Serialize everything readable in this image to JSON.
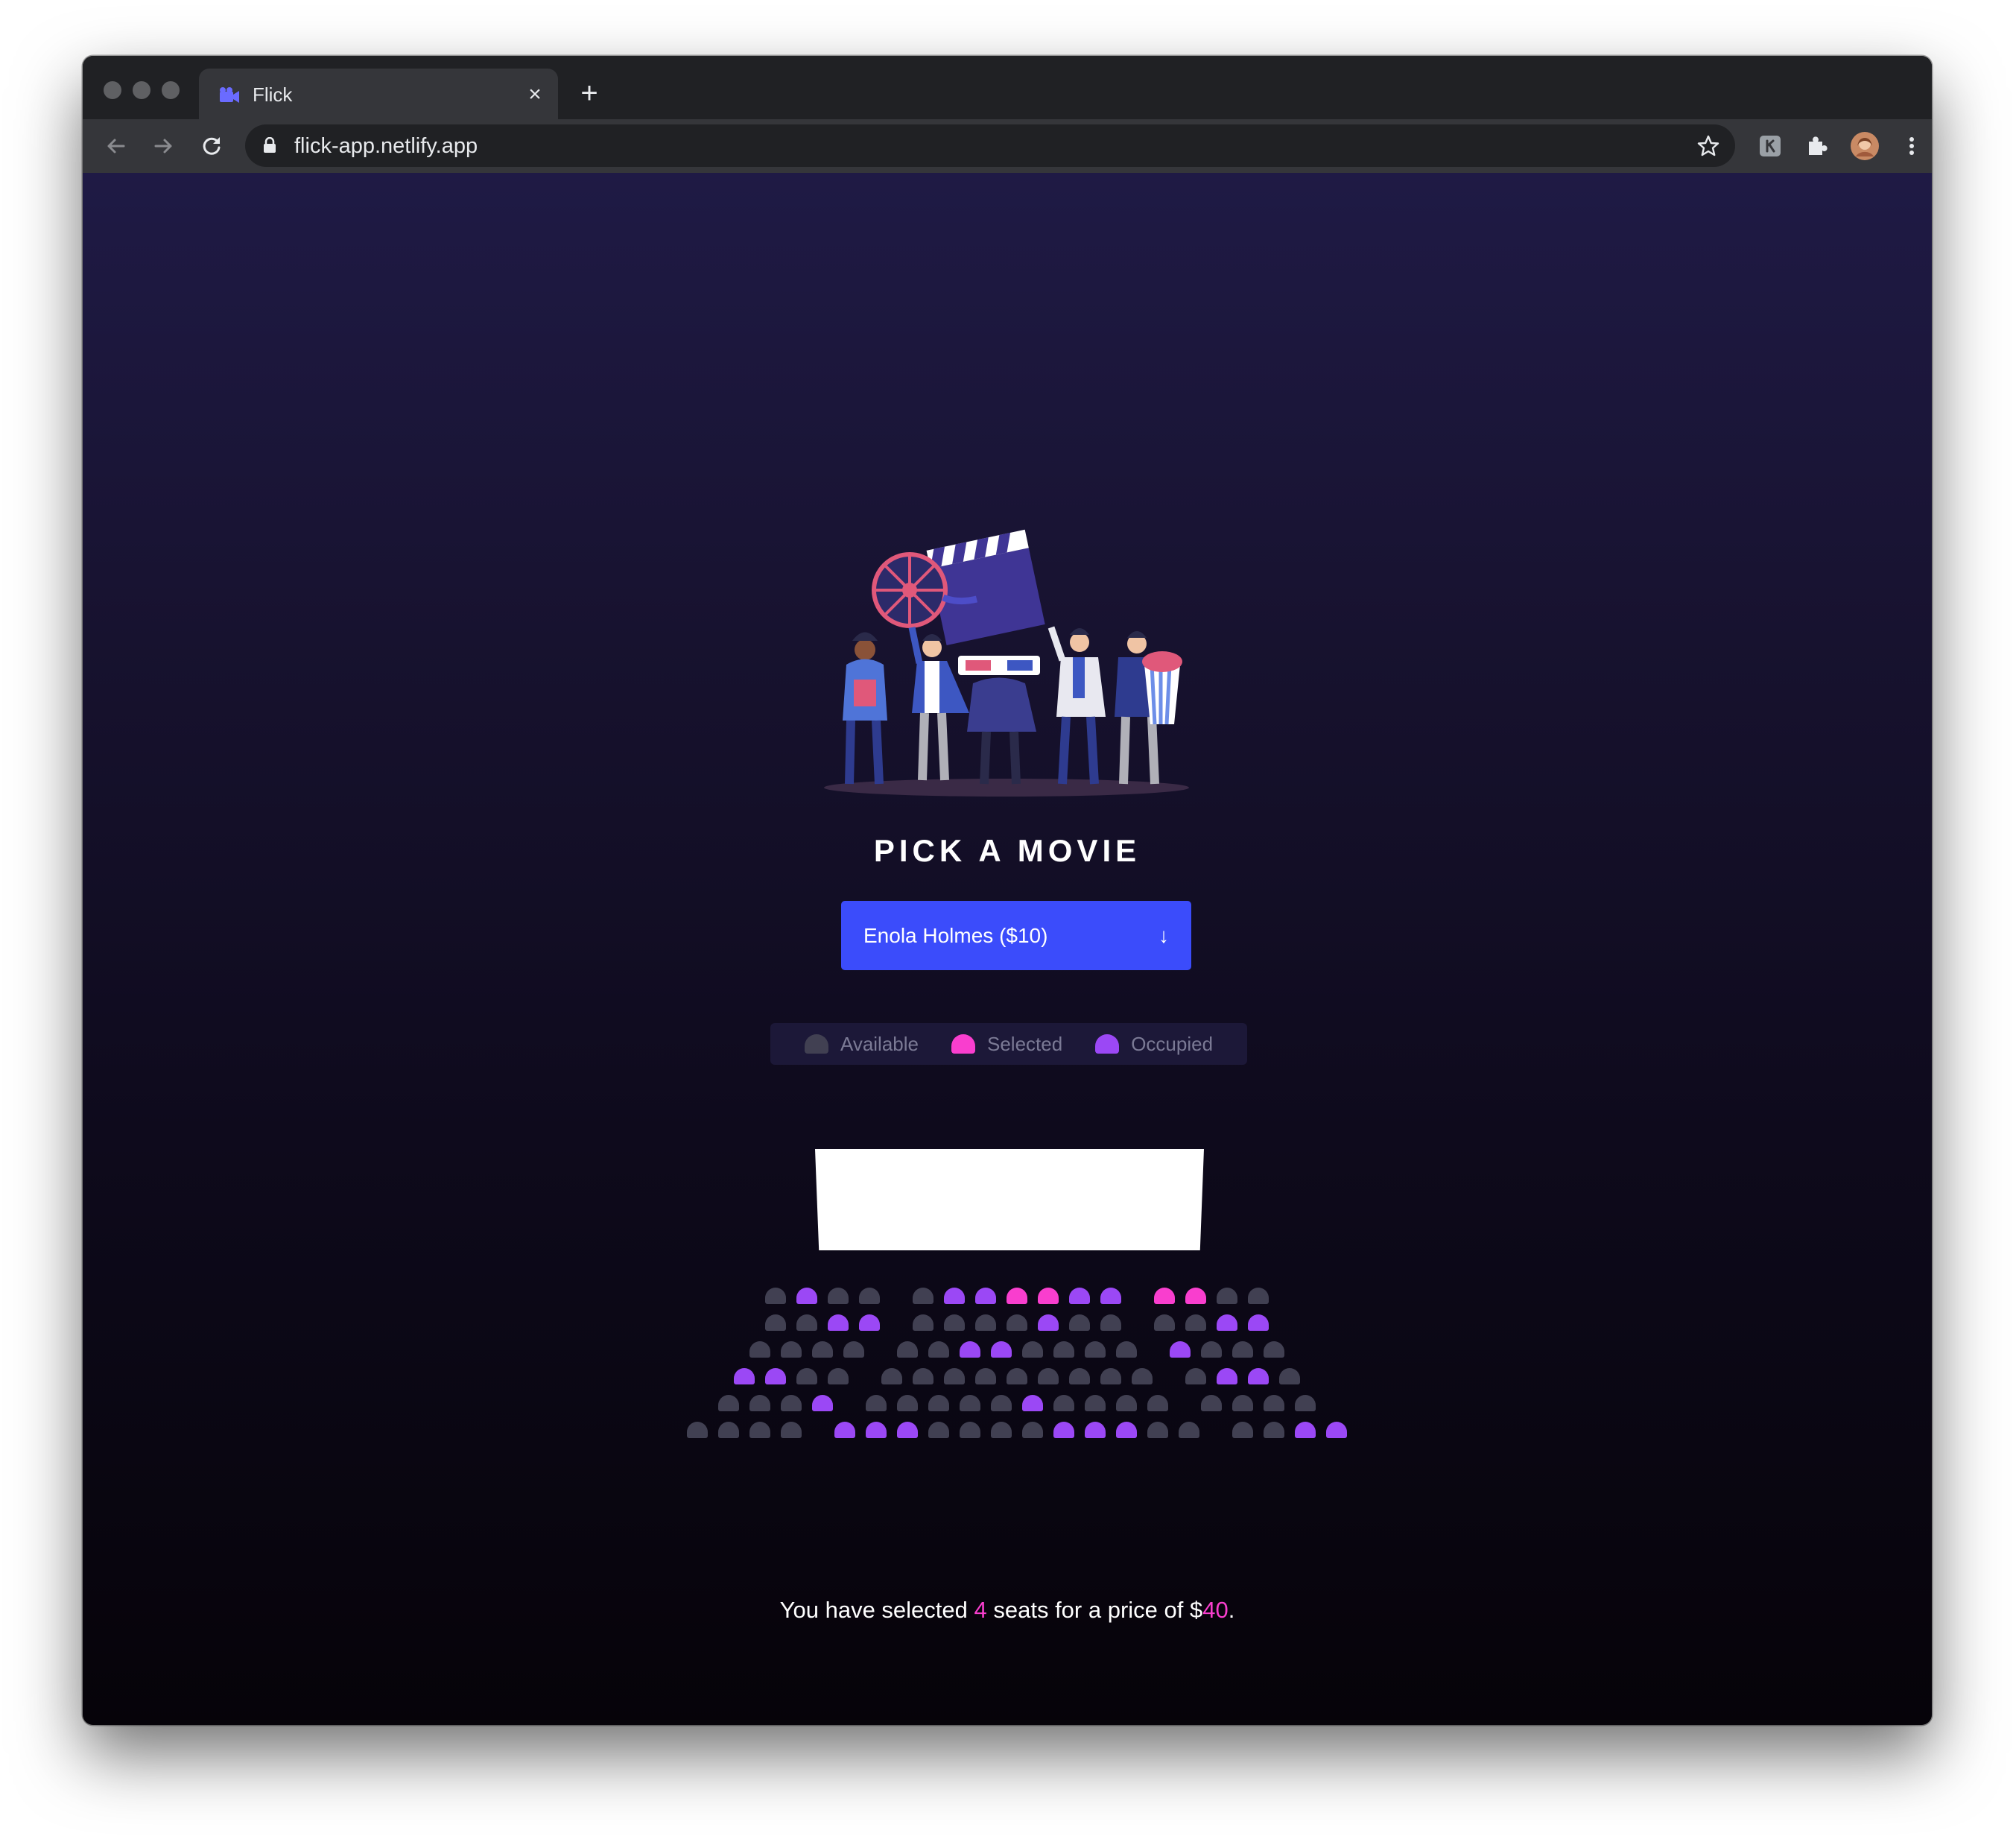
{
  "browser": {
    "tab_title": "Flick",
    "tab_close": "×",
    "new_tab": "+",
    "url": "flick-app.netlify.app"
  },
  "page": {
    "heading": "PICK A MOVIE",
    "movie_select": {
      "selected": "Enola Holmes ($10)",
      "arrow": "↓"
    },
    "legend": {
      "available": "Available",
      "selected": "Selected",
      "occupied": "Occupied"
    },
    "summary": {
      "prefix": "You have selected ",
      "count": "4",
      "middle": " seats for a price of $",
      "price": "40",
      "suffix": "."
    }
  },
  "colors": {
    "accent": "#3b4cfb",
    "available": "#414052",
    "selected": "#f93ece",
    "occupied": "#9b48f5"
  },
  "seat_map": {
    "legend_codes": {
      "a": "available",
      "s": "selected",
      "o": "occupied"
    },
    "rows": [
      {
        "left": "aoaa",
        "mid": "aoossoo",
        "right": "ssaa"
      },
      {
        "left": "aaoo",
        "mid": "aaaaoaa",
        "right": "aaoo"
      },
      {
        "left": "aaaa",
        "mid": "aaooaaaa",
        "right": "oaaa"
      },
      {
        "left": "ooaa",
        "mid": "aaaaaaaaa",
        "right": "aooa"
      },
      {
        "left": "aaao",
        "mid": "aaaaaoaaaa",
        "right": "aaaa"
      },
      {
        "left": "aaaa",
        "mid": "oooaaaaoooaa",
        "right": "aaoo"
      }
    ]
  }
}
